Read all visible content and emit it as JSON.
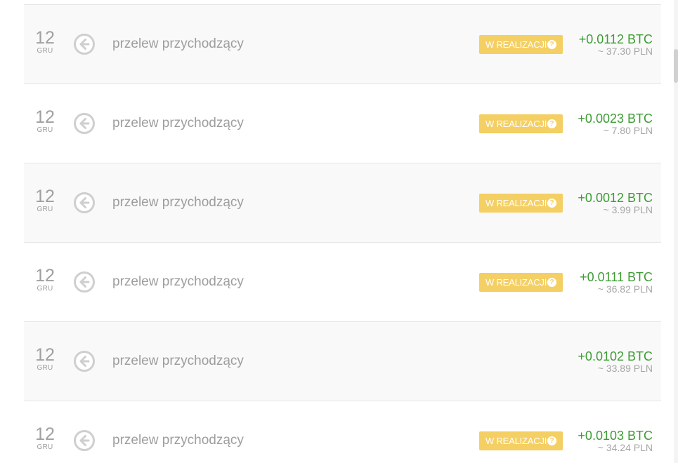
{
  "transactions": [
    {
      "day": "12",
      "month": "GRU",
      "icon": "arrow-left-circle-icon",
      "description": "przelew przychodzący",
      "status": "W REALIZACJI",
      "status_help": "?",
      "btc": "+0.0112 BTC",
      "pln": "~ 37.30 PLN"
    },
    {
      "day": "12",
      "month": "GRU",
      "icon": "arrow-left-circle-icon",
      "description": "przelew przychodzący",
      "status": "W REALIZACJI",
      "status_help": "?",
      "btc": "+0.0023 BTC",
      "pln": "~ 7.80 PLN"
    },
    {
      "day": "12",
      "month": "GRU",
      "icon": "arrow-left-circle-icon",
      "description": "przelew przychodzący",
      "status": "W REALIZACJI",
      "status_help": "?",
      "btc": "+0.0012 BTC",
      "pln": "~ 3.99 PLN"
    },
    {
      "day": "12",
      "month": "GRU",
      "icon": "arrow-left-circle-icon",
      "description": "przelew przychodzący",
      "status": "W REALIZACJI",
      "status_help": "?",
      "btc": "+0.0111 BTC",
      "pln": "~ 36.82 PLN"
    },
    {
      "day": "12",
      "month": "GRU",
      "icon": "arrow-left-circle-icon",
      "description": "przelew przychodzący",
      "status": "",
      "status_help": "",
      "btc": "+0.0102 BTC",
      "pln": "~ 33.89 PLN"
    },
    {
      "day": "12",
      "month": "GRU",
      "icon": "arrow-left-circle-icon",
      "description": "przelew przychodzący",
      "status": "W REALIZACJI",
      "status_help": "?",
      "btc": "+0.0103 BTC",
      "pln": "~ 34.24 PLN"
    }
  ],
  "colors": {
    "amount_positive": "#3e9c35",
    "badge_background": "#f4cf63",
    "muted_text": "#9d9d9d",
    "row_alt_background": "#f9f9f9"
  }
}
